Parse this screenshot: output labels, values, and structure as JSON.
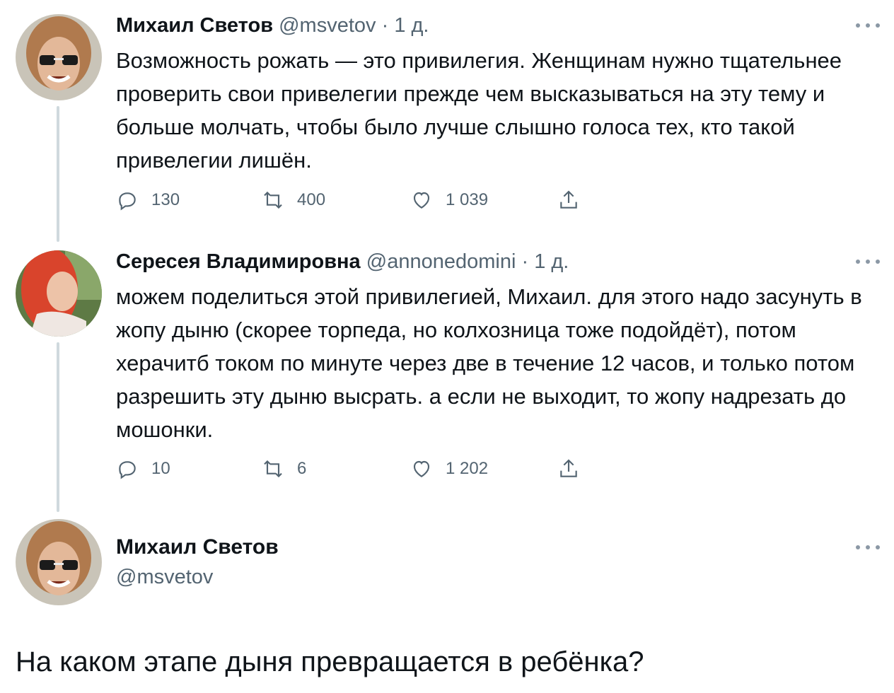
{
  "thread": [
    {
      "name": "Михаил Светов",
      "handle": "@msvetov",
      "separator": "·",
      "time": "1 д.",
      "text": "Возможность рожать — это привилегия. Женщинам нужно тщательнее проверить свои привелегии прежде чем высказываться на эту тему и больше молчать, чтобы было лучше слышно голоса тех, кто такой привелегии лишён.",
      "replies": "130",
      "retweets": "400",
      "likes": "1 039"
    },
    {
      "name": "Сересея Владимировна",
      "handle": "@annonedomini",
      "separator": "·",
      "time": "1 д.",
      "text": "можем поделиться этой привилегией, Михаил. для этого надо засунуть в жопу дыню (скорее торпеда, но колхозница тоже подойдёт), потом херачитб током по минуте через две в течение 12 часов, и только потом разрешить эту дыню высрать. а если не выходит, то жопу надрезать до мошонки.",
      "replies": "10",
      "retweets": "6",
      "likes": "1 202"
    }
  ],
  "main_tweet": {
    "name": "Михаил Светов",
    "handle": "@msvetov",
    "text": "На каком этапе дыня превращается в ребёнка?"
  },
  "colors": {
    "text": "#0f1419",
    "secondary": "#536471",
    "thread_line": "#cfd9de"
  }
}
